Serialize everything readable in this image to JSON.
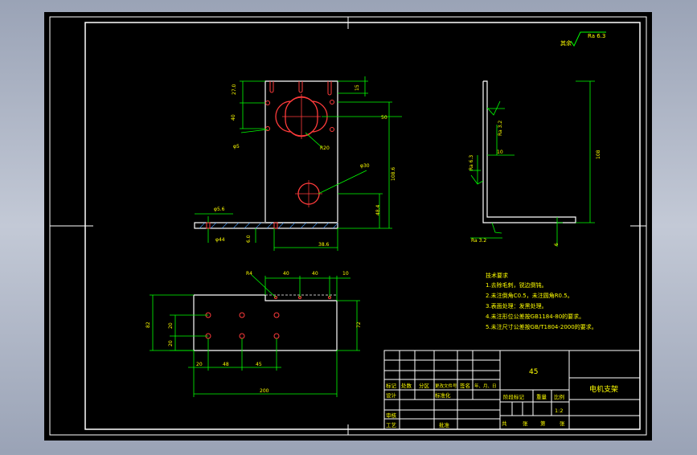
{
  "roughness": {
    "label": "其余",
    "value": "Ra 6.3"
  },
  "front_view": {
    "dims": {
      "top_a": "27.0",
      "top_b": "15",
      "mid_left": "40",
      "right_a": "50",
      "right_b": "108.6",
      "right_c": "48.4",
      "hole_small": "φ5.6",
      "hole_bottom": "φ44",
      "slot": "R20",
      "big_hole": "φ30",
      "bottom_span": "38.6",
      "bottom_plate": "6.0",
      "leader_left": "φ5"
    }
  },
  "side_view": {
    "dims": {
      "height": "108",
      "ra_1": "Ra 3.2",
      "ra_2": "Ra 6.3",
      "ra_3": "Ra 3.2",
      "inner": "10",
      "thick": "6"
    }
  },
  "top_view": {
    "dims": {
      "r": "R4",
      "d40a": "40",
      "d40b": "40",
      "d10": "10",
      "h82": "82",
      "h72": "72",
      "r20": "20",
      "r20b": "20",
      "b20": "20",
      "b48": "48",
      "b45": "45",
      "width": "200"
    }
  },
  "tech_notes": {
    "title": "技术要求",
    "items": [
      "1.去除毛刺，锐边倒钝。",
      "2.未注倒角C0.5，未注圆角R0.5。",
      "3.表面处理：发黑处理。",
      "4.未注形位公差按GB1184-80的要求。",
      "5.未注尺寸公差按GB/T1804-2000的要求。"
    ]
  },
  "title_block": {
    "material": "45",
    "part_name": "电机支架",
    "scale": "1:2",
    "cells": {
      "mark": "标记",
      "count": "处数",
      "zone": "分区",
      "change_doc": "更改文件号",
      "sign": "签名",
      "date": "年、月、日",
      "design": "设计",
      "standardize": "标准化",
      "stage_mark": "阶段标记",
      "weight": "重量",
      "ratio": "比例",
      "check": "审核",
      "process": "工艺",
      "approve": "批准",
      "total": "共",
      "sheet": "张",
      "page_of": "第",
      "page": "张"
    }
  }
}
